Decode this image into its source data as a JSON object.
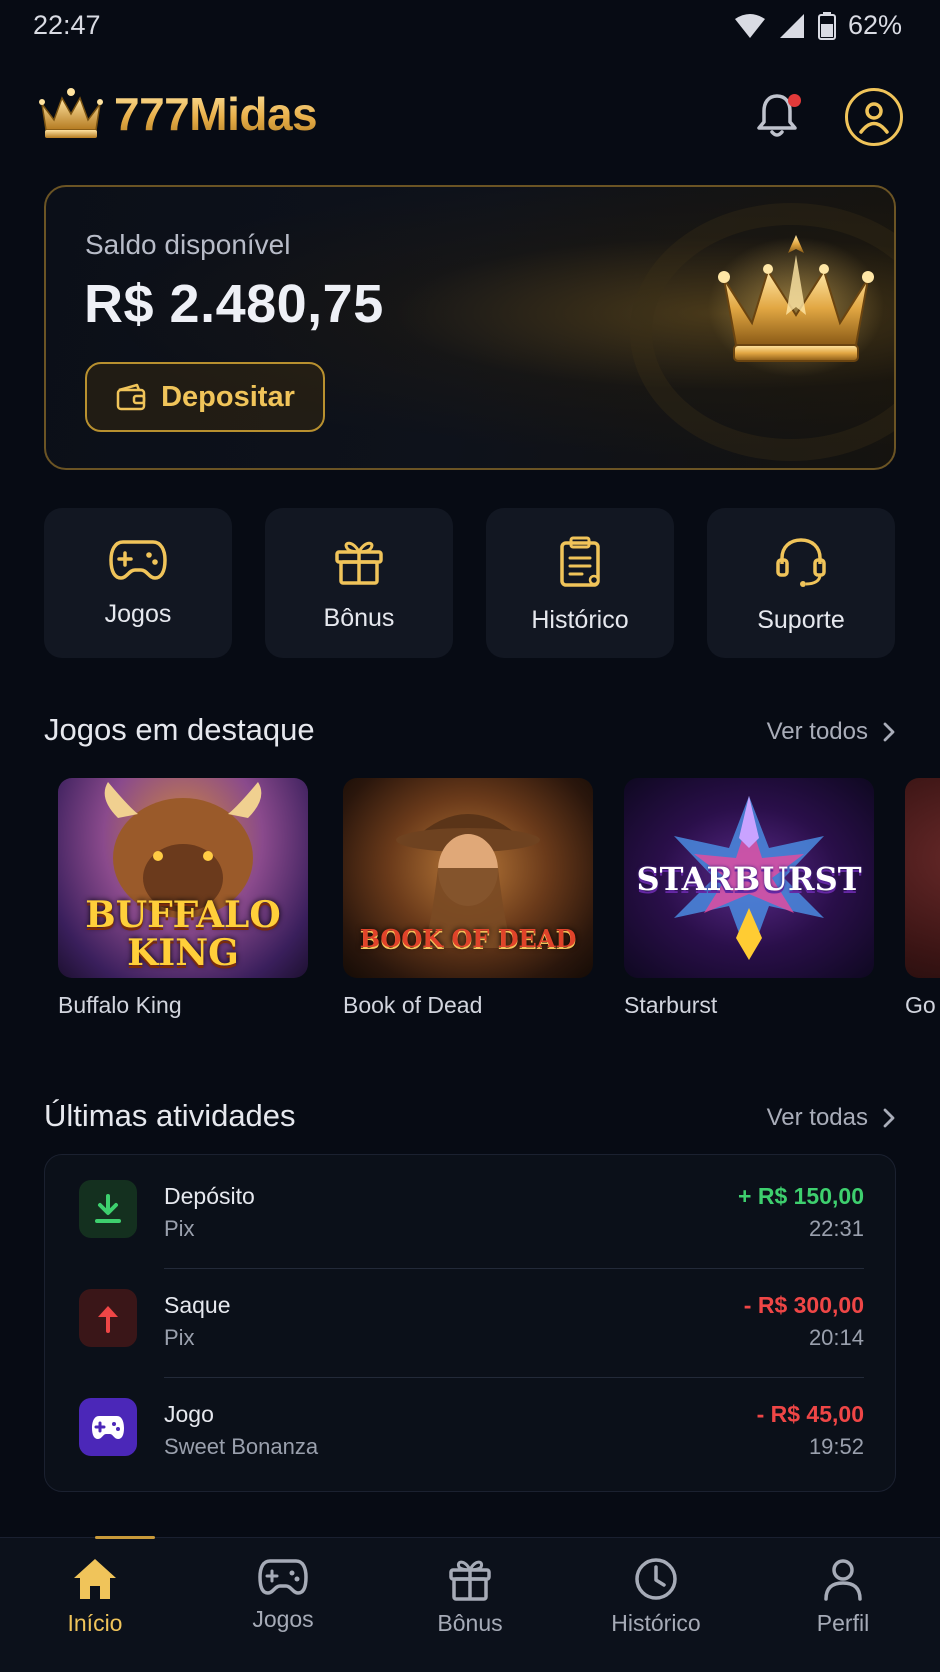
{
  "status_bar": {
    "time": "22:47",
    "battery": "62%"
  },
  "header": {
    "brand": "777Midas",
    "brand_icon": "crown-icon",
    "has_notification": true
  },
  "balance": {
    "label": "Saldo disponível",
    "amount": "R$ 2.480,75",
    "deposit_label": "Depositar"
  },
  "quick_actions": [
    {
      "label": "Jogos",
      "icon": "gamepad-icon"
    },
    {
      "label": "Bônus",
      "icon": "gift-icon"
    },
    {
      "label": "Histórico",
      "icon": "clipboard-icon"
    },
    {
      "label": "Suporte",
      "icon": "headset-icon"
    }
  ],
  "featured": {
    "title": "Jogos em destaque",
    "see_all": "Ver todos",
    "games": [
      {
        "name": "Buffalo King",
        "logo_text": "BUFFALO KING"
      },
      {
        "name": "Book of Dead",
        "logo_text": "BOOK OF DEAD"
      },
      {
        "name": "Starburst",
        "logo_text": "STARBURST"
      },
      {
        "name": "Go"
      }
    ]
  },
  "activities": {
    "title": "Últimas atividades",
    "see_all": "Ver todas",
    "items": [
      {
        "title": "Depósito",
        "sub": "Pix",
        "amount": "+ R$ 150,00",
        "time": "22:31",
        "icon": "download-icon",
        "color": "#3ecf6e"
      },
      {
        "title": "Saque",
        "sub": "Pix",
        "amount": "- R$ 300,00",
        "time": "20:14",
        "icon": "arrow-up-icon",
        "color": "#ef4646"
      },
      {
        "title": "Jogo",
        "sub": "Sweet Bonanza",
        "amount": "- R$ 45,00",
        "time": "19:52",
        "icon": "gamepad-icon",
        "color": "#ef4646"
      }
    ]
  },
  "nav": [
    {
      "label": "Início",
      "icon": "home-icon",
      "active": true
    },
    {
      "label": "Jogos",
      "icon": "gamepad-icon",
      "active": false
    },
    {
      "label": "Bônus",
      "icon": "gift-icon",
      "active": false
    },
    {
      "label": "Histórico",
      "icon": "clock-icon",
      "active": false
    },
    {
      "label": "Perfil",
      "icon": "user-icon",
      "active": false
    }
  ],
  "colors": {
    "accent": "#f0c45a",
    "positive": "#3ecf6e",
    "negative": "#ef4646",
    "background": "#070b14"
  }
}
